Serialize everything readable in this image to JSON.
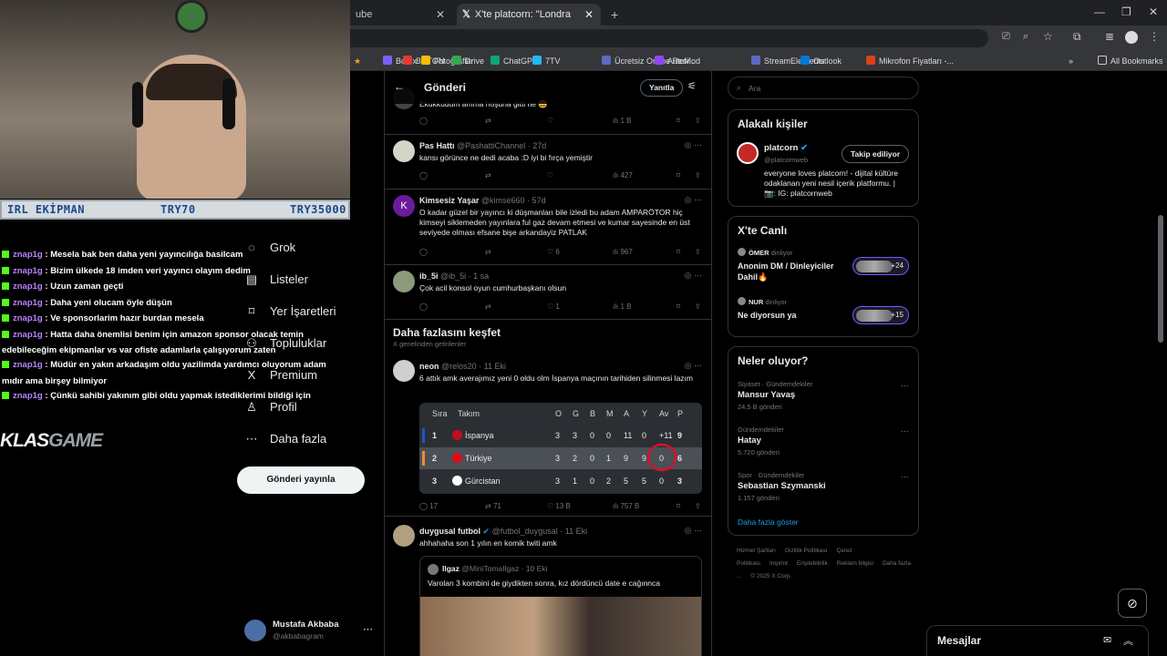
{
  "browser": {
    "tabs": [
      {
        "label": "ube"
      },
      {
        "label": "X'te platcorn: \"Londra sokakları"
      }
    ],
    "new_tab": "+",
    "bookmarks": [
      {
        "label": "Botrix",
        "color": "#7b61ff"
      },
      {
        "label": "BUTON",
        "color": "#e53935"
      },
      {
        "label": "Fotoğraflar",
        "color": "#fbbc04"
      },
      {
        "label": "Drive",
        "color": "#34a853"
      },
      {
        "label": "ChatGPT",
        "color": "#10a37f"
      },
      {
        "label": "7TV",
        "color": "#29b6f6"
      },
      {
        "label": "Ücretsiz Online Resi...",
        "color": "#5c6bc0"
      },
      {
        "label": "AutoMod",
        "color": "#9146ff"
      },
      {
        "label": "StreamElements",
        "color": "#5c6bc0"
      },
      {
        "label": "Outlook",
        "color": "#0078d4"
      },
      {
        "label": "Mikrofon Fiyatları -...",
        "color": "#d84315"
      }
    ],
    "all_bookmarks": "All Bookmarks"
  },
  "stream": {
    "overlay": {
      "left": "IRL EKİPMAN",
      "mid": "TRY70",
      "right": "TRY35000"
    },
    "chat": [
      {
        "user": "znap1g",
        "msg": "Mesela bak ben daha yeni yayıncılığa basilcam"
      },
      {
        "user": "znap1g",
        "msg": "Bizim ülkede 18 imden veri yayıncı olayım dedim"
      },
      {
        "user": "znap1g",
        "msg": "Uzun zaman geçti"
      },
      {
        "user": "znap1g",
        "msg": "Daha yeni olucam öyle düşün"
      },
      {
        "user": "znap1g",
        "msg": "Ve sponsorlarim hazır burdan mesela"
      },
      {
        "user": "znap1g",
        "msg": "Hatta daha önemlisi benim için amazon sponsor olacak temin",
        "cont": "edebileceğim ekipmanlar vs var ofiste adamlarla çalışıyorum zaten"
      },
      {
        "user": "znap1g",
        "msg": "Müdür en yakın arkadaşım oldu yazilimda yardımcı oluyorum adam",
        "cont": "mıdır ama birşey bilmiyor"
      },
      {
        "user": "znap1g",
        "msg": "Çünkü sahibi yakınım gibi oldu yapmak istediklerimi bildiği için"
      }
    ],
    "logo": {
      "a": "KLAS",
      "b": "GAME"
    }
  },
  "sidebar": {
    "items": [
      {
        "label": "Grok",
        "icon": "◌"
      },
      {
        "label": "Listeler",
        "icon": "▤"
      },
      {
        "label": "Yer İşaretleri",
        "icon": "⌑"
      },
      {
        "label": "Topluluklar",
        "icon": "⚇"
      },
      {
        "label": "Premium",
        "icon": "X"
      },
      {
        "label": "Profil",
        "icon": "♙"
      },
      {
        "label": "Daha fazla",
        "icon": "⋯"
      }
    ],
    "post_button": "Gönderi yayınla",
    "account": {
      "name": "Mustafa Akbaba",
      "handle": "@akbabagram"
    }
  },
  "header": {
    "title": "Gönderi",
    "reply": "Yanıtla"
  },
  "tweets": [
    {
      "text": "Ekukkudum amma hoşuna gitti ne 😄",
      "views": "1 B"
    },
    {
      "name": "Pas Hattı",
      "handle": "@PashattiChannel · 27d",
      "text": "kansı görünce ne dedi acaba :D iyi bi fırça yemiştir",
      "views": "427"
    },
    {
      "name": "Kimsesiz Yaşar",
      "handle": "@kimse660 · 57d",
      "text": "O kadar güzel bir yayıncı ki düşmanları bile izledi bu adam AMPARÖTOR hiç kimseyi siklemeden yayınlara ful gaz devam etmesi ve kumar sayesinde en üst seviyede olması efsane bişe arkandayiz PATLAK",
      "likes": "6",
      "views": "967"
    },
    {
      "name": "ib_5i",
      "handle": "@ib_5i · 1 sa",
      "text": "Çok acil konsol oyun cumhurbaşkanı olsun",
      "likes": "1",
      "views": "1 B"
    }
  ],
  "discover": {
    "title": "Daha fazlasını keşfet",
    "subtitle": "X genelinden getirilenler"
  },
  "neon_tweet": {
    "name": "neon",
    "handle": "@relos20 · 11 Eki",
    "text": "6 attık amk averajımız yeni 0 oldu olm İspanya maçının tarihiden silinmesi lazım",
    "replies": "17",
    "retweets": "71",
    "likes": "13 B",
    "views": "757 B"
  },
  "table": {
    "headers": [
      "Sıra",
      "Takım",
      "O",
      "G",
      "B",
      "M",
      "A",
      "Y",
      "Av",
      "P"
    ],
    "rows": [
      {
        "rank": "1",
        "team": "İspanya",
        "o": "3",
        "g": "3",
        "b": "0",
        "m": "0",
        "a": "11",
        "y": "0",
        "av": "+11",
        "p": "9",
        "bar": "#1e56c8"
      },
      {
        "rank": "2",
        "team": "Türkiye",
        "o": "3",
        "g": "2",
        "b": "0",
        "m": "1",
        "a": "9",
        "y": "9",
        "av": "0",
        "p": "6",
        "bar": "#f28c28"
      },
      {
        "rank": "3",
        "team": "Gürcistan",
        "o": "3",
        "g": "1",
        "b": "0",
        "m": "2",
        "a": "5",
        "y": "5",
        "av": "0",
        "p": "3",
        "bar": "transparent"
      }
    ]
  },
  "duygusal": {
    "name": "duygusal futbol",
    "handle": "@futbol_duygusal · 11 Eki",
    "text": "ahhahaha son 1 yılın en komik twiti amk",
    "quote": {
      "name": "Ilgaz",
      "handle": "@MiniTomaIlgaz · 10 Eki",
      "text": "Varolan 3 kombini de giydikten sonra, kız dördüncü date e cağınnca"
    }
  },
  "right": {
    "search_placeholder": "Ara",
    "people": {
      "title": "Alakalı kişiler",
      "name": "platcorn",
      "handle": "@platcornweb",
      "follow": "Takip ediliyor",
      "bio": "everyone loves platcorn! - dijital kültüre odaklanan yeni nesil içerik platformu. | 📷: IG: platcornweb"
    },
    "live": {
      "title": "X'te Canlı",
      "items": [
        {
          "host": "ÖMER",
          "status": "dinliyor",
          "title": "Anonim DM / Dinleyiciler Dahil🔥",
          "count": "+24"
        },
        {
          "host": "NUR",
          "status": "dinliyor",
          "title": "Ne diyorsun ya",
          "count": "+15"
        }
      ]
    },
    "trends": {
      "title": "Neler oluyor?",
      "items": [
        {
          "cat": "Siyaset · Gündemdekiler",
          "name": "Mansur Yavaş",
          "count": "24,5 B gönderi"
        },
        {
          "cat": "Gündemdekiler",
          "name": "Hatay",
          "count": "5.720 gönderi"
        },
        {
          "cat": "Spor · Gündemdekiler",
          "name": "Sebastian Szymanski",
          "count": "1.157 gönderi"
        }
      ],
      "more": "Daha fazla göster"
    },
    "footer": [
      "Hizmet Şartları",
      "Gizlilik Politikası",
      "Çerez Politikası",
      "Imprint",
      "Erişilebilirlik",
      "Reklam bilgisi",
      "Daha fazla ...",
      "© 2025 X Corp."
    ]
  },
  "messages": {
    "label": "Mesajlar"
  }
}
